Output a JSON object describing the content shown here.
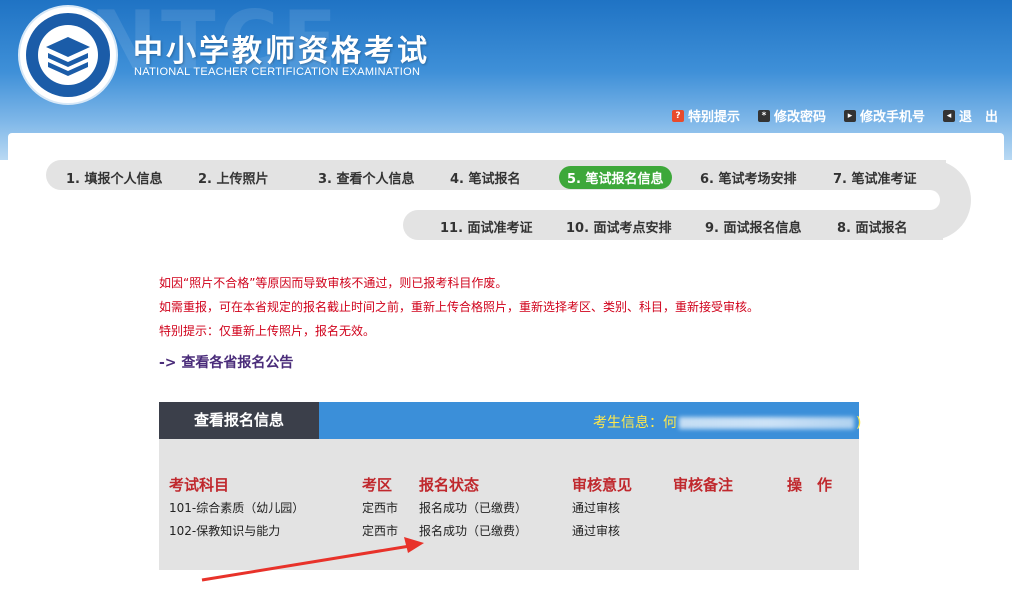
{
  "header": {
    "watermark": "NTCE",
    "title": "中小学教师资格考试",
    "subtitle": "NATIONAL TEACHER CERTIFICATION EXAMINATION",
    "nav": [
      {
        "label": "特别提示",
        "icon": "alert-icon"
      },
      {
        "label": "修改密码",
        "icon": "key-icon"
      },
      {
        "label": "修改手机号",
        "icon": "phone-icon"
      },
      {
        "label": "退　出",
        "icon": "logout-icon"
      }
    ]
  },
  "steps": [
    "1. 填报个人信息",
    "2. 上传照片",
    "3. 查看个人信息",
    "4. 笔试报名",
    "5. 笔试报名信息",
    "6. 笔试考场安排",
    "7. 笔试准考证",
    "11. 面试准考证",
    "10. 面试考点安排",
    "9. 面试报名信息",
    "8. 面试报名"
  ],
  "active_step": "5. 笔试报名信息",
  "notices": [
    "如因“照片不合格”等原因而导致审核不通过，则已报考科目作废。",
    "如需重报，可在本省规定的报名截止时间之前，重新上传合格照片，重新选择考区、类别、科目，重新接受审核。",
    "特别提示：仅重新上传照片，报名无效。"
  ],
  "announcement_link": "-> 查看各省报名公告",
  "panel": {
    "tab_label": "查看报名信息",
    "examinee_prefix": "考生信息：何",
    "examinee_suffix": ")",
    "columns": [
      "考试科目",
      "考区",
      "报名状态",
      "审核意见",
      "审核备注",
      "操　作"
    ],
    "rows": [
      {
        "subject": "101-综合素质（幼儿园）",
        "region": "定西市",
        "status": "报名成功（已缴费）",
        "review": "通过审核",
        "note": "",
        "action": ""
      },
      {
        "subject": "102-保教知识与能力",
        "region": "定西市",
        "status": "报名成功（已缴费）",
        "review": "通过审核",
        "note": "",
        "action": ""
      }
    ]
  },
  "colors": {
    "header_blue": "#2b7cc9",
    "active_step": "#3da83a",
    "notice_red": "#d0021b",
    "column_red": "#c0282d",
    "panel_blue": "#3b8fd9",
    "tab_dark": "#3b3f4a",
    "examinee_yellow": "#ffe84a",
    "arrow_red": "#e8322a"
  }
}
